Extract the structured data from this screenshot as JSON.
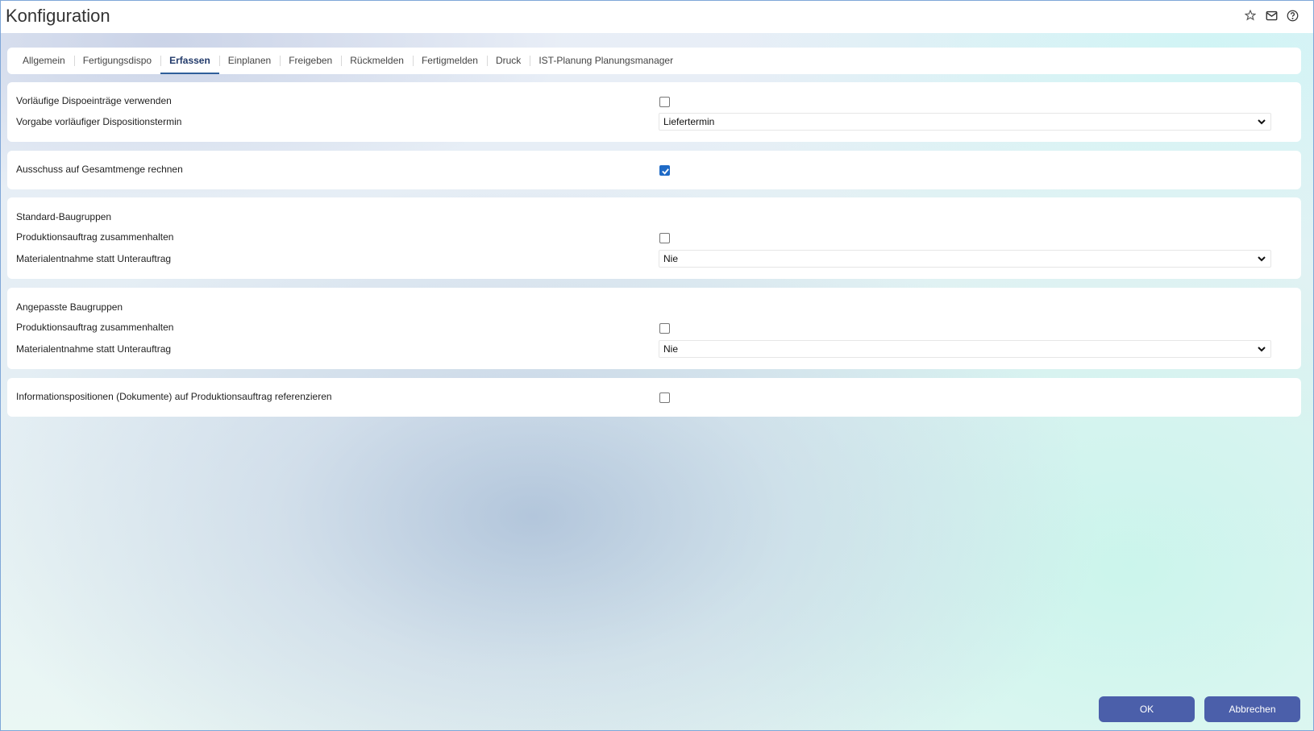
{
  "window": {
    "title": "Konfiguration"
  },
  "title_icons": [
    "star-icon",
    "mail-icon",
    "help-icon"
  ],
  "tabs": [
    {
      "label": "Allgemein",
      "active": false
    },
    {
      "label": "Fertigungsdispo",
      "active": false
    },
    {
      "label": "Erfassen",
      "active": true
    },
    {
      "label": "Einplanen",
      "active": false
    },
    {
      "label": "Freigeben",
      "active": false
    },
    {
      "label": "Rückmelden",
      "active": false
    },
    {
      "label": "Fertigmelden",
      "active": false
    },
    {
      "label": "Druck",
      "active": false
    },
    {
      "label": "IST-Planung Planungsmanager",
      "active": false
    }
  ],
  "section1": {
    "provisional_label": "Vorläufige Dispoeinträge verwenden",
    "provisional_checked": false,
    "default_date_label": "Vorgabe vorläufiger Dispositionstermin",
    "default_date_value": "Liefertermin"
  },
  "section2": {
    "scrap_label": "Ausschuss auf Gesamtmenge rechnen",
    "scrap_checked": true
  },
  "section3": {
    "heading": "Standard-Baugruppen",
    "keep_label": "Produktionsauftrag zusammenhalten",
    "keep_checked": false,
    "material_label": "Materialentnahme statt Unterauftrag",
    "material_value": "Nie"
  },
  "section4": {
    "heading": "Angepasste Baugruppen",
    "keep_label": "Produktionsauftrag zusammenhalten",
    "keep_checked": false,
    "material_label": "Materialentnahme statt Unterauftrag",
    "material_value": "Nie"
  },
  "section5": {
    "info_label": "Informationspositionen (Dokumente) auf Produktionsauftrag referenzieren",
    "info_checked": false
  },
  "footer": {
    "ok_label": "OK",
    "cancel_label": "Abbrechen"
  },
  "colors": {
    "accent": "#4b5faa",
    "checkbox": "#1f6ac6",
    "tab_underline": "#2f5f9a"
  }
}
